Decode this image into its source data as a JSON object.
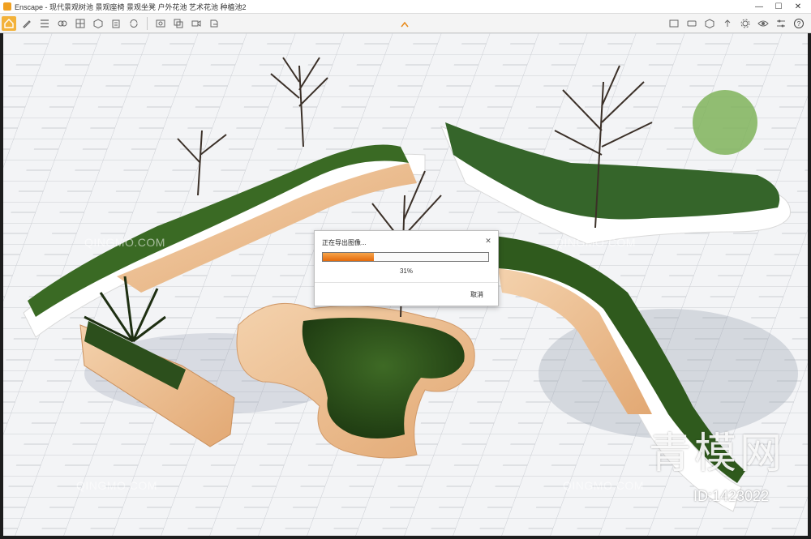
{
  "window": {
    "title": "Enscape - 现代景观树池 景观座椅 景观坐凳 户外花池 艺术花池 种植池2",
    "minimize": "—",
    "maximize": "☐",
    "close": "✕"
  },
  "toolbar": {
    "left_icons": [
      "home-icon",
      "pen-icon",
      "list-icon",
      "eye-icon",
      "link-icon",
      "cube-icon",
      "camera-icon",
      "video-icon",
      "image-icon",
      "sync-icon",
      "export-icon",
      "screenshot-icon"
    ],
    "right_icons": [
      "asset-library-icon",
      "panorama-icon",
      "upload-icon",
      "settings-icon",
      "visual-settings-icon",
      "eye-icon",
      "sliders-icon",
      "help-icon"
    ]
  },
  "dialog": {
    "title": "正在导出图像...",
    "close": "✕",
    "progress": 0.31,
    "percent_text": "31%",
    "cancel_label": "取消"
  },
  "watermark": {
    "logo_text": "青模网",
    "id_text": "ID:1423022",
    "repeat_text": "QINGMO.COM"
  },
  "colors": {
    "accent": "#f3b23a",
    "progress": "#e36a0c"
  }
}
